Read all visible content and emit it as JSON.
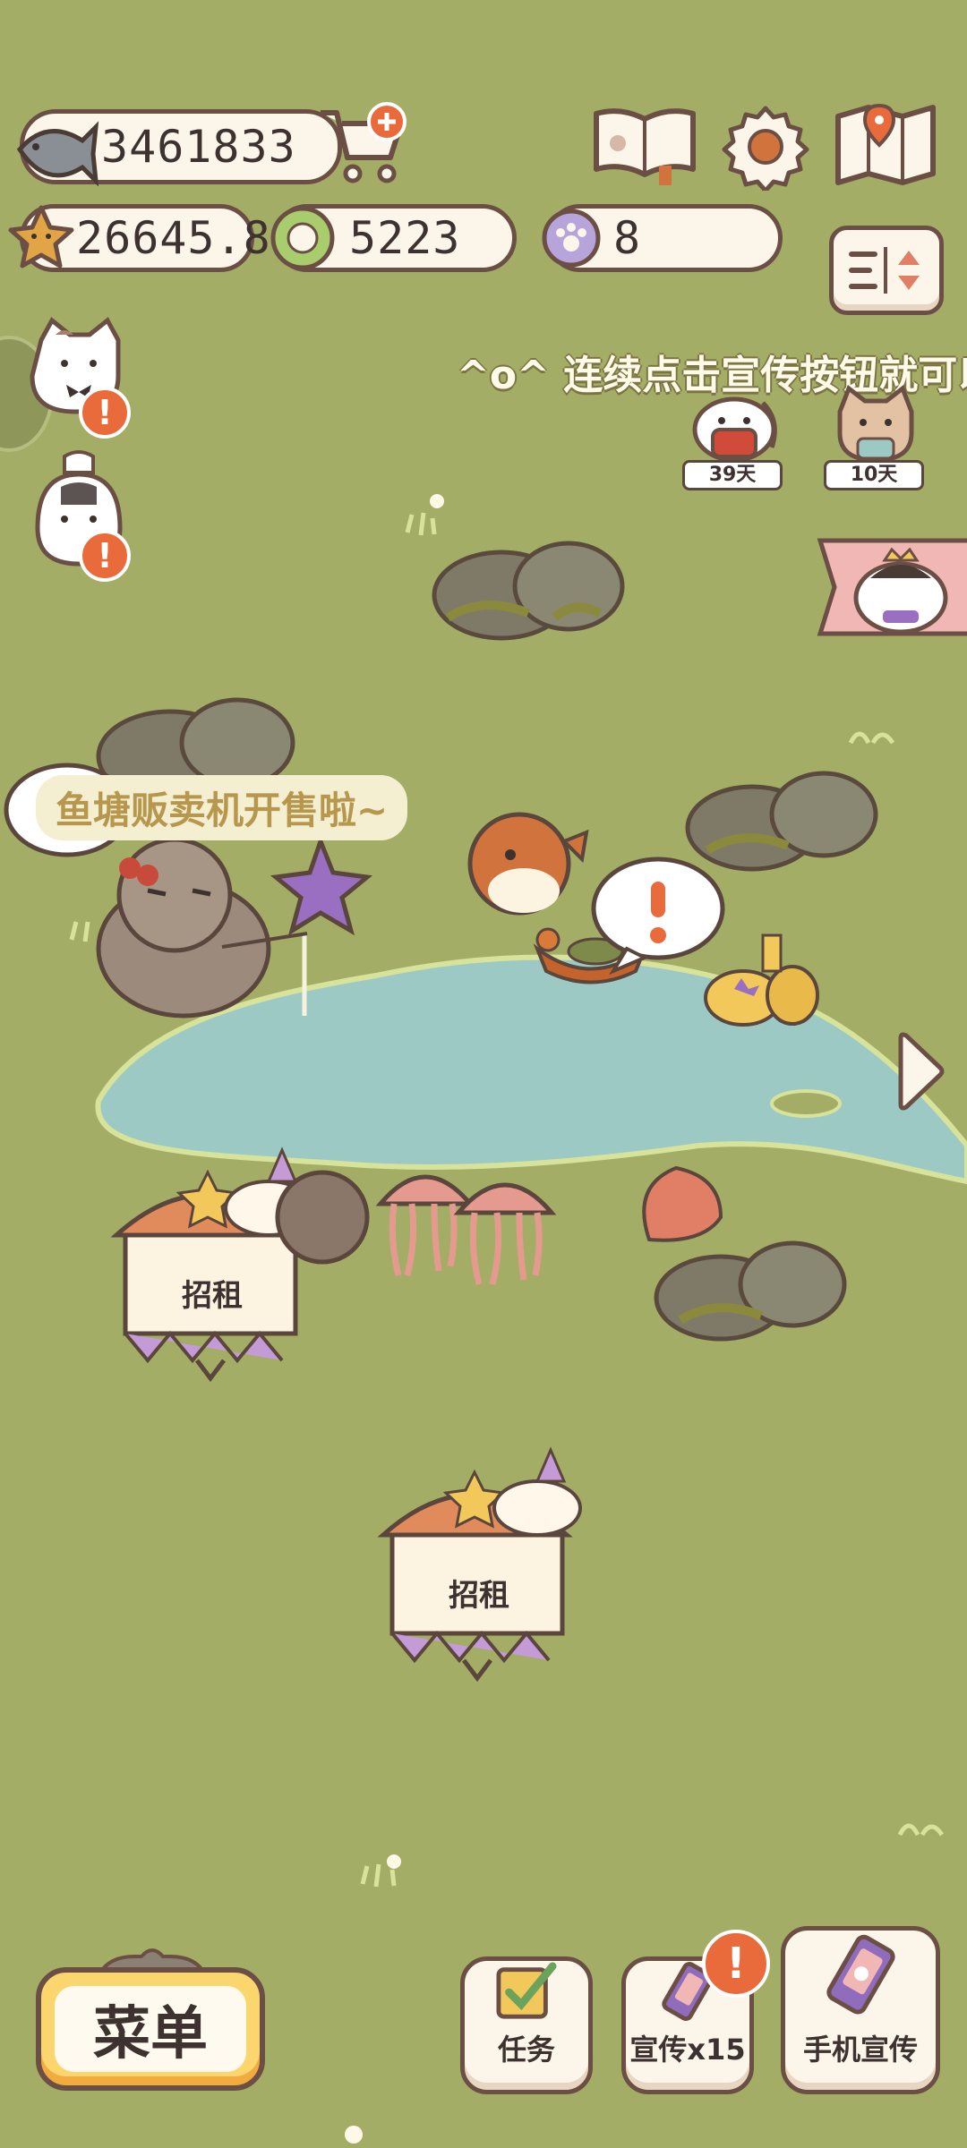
{
  "currencies": {
    "fish": "3461833",
    "star": "26645.8",
    "leaf": "5223",
    "paw": "8"
  },
  "top_icons": [
    "shop-cart-icon",
    "paw-book-icon",
    "settings-gear-icon",
    "map-icon",
    "sort-toggle-icon"
  ],
  "marquee_text": "^o^ 连续点击宣传按钮就可以",
  "visitors": [
    {
      "days": "39天"
    },
    {
      "days": "10天"
    }
  ],
  "speech_bubble": "鱼塘贩卖机开售啦~",
  "stalls": [
    {
      "sign": "招租"
    },
    {
      "sign": "招租"
    }
  ],
  "bottom": {
    "menu": "菜单",
    "task": "任务",
    "promo": "宣传x15",
    "phone_promo": "手机宣传"
  },
  "colors": {
    "grass": "#a4ad65",
    "pond": "#9cc9c4",
    "badge": "#e96b3b",
    "outline": "#6b4f45"
  }
}
